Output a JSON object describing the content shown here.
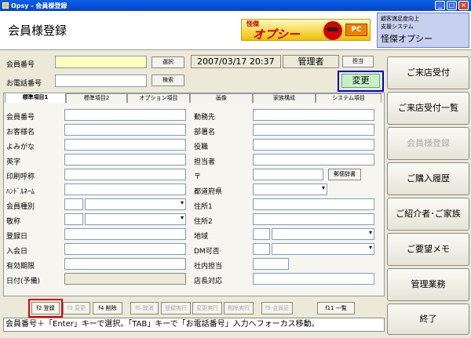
{
  "window": {
    "title": "Opsy - 会員様登録"
  },
  "header": {
    "page_title": "会員様登録",
    "logo_small": "怪傑",
    "logo_main": "オプシー",
    "logo_pc": "PC",
    "sys_line1": "顧客満足度向上",
    "sys_line2": "支援システム",
    "sys_line3": "怪傑オプシー"
  },
  "top": {
    "member_no_label": "会員番号",
    "phone_label": "お電話番号",
    "select_btn": "選択",
    "search_btn": "検索",
    "datetime": "2007/03/17 20:37",
    "staff": "管理者",
    "staff_btn": "担当",
    "change_btn": "変更"
  },
  "tabs": [
    "標準項目1",
    "標準項目2",
    "オプション項目",
    "画像",
    "家族構成",
    "システム項目"
  ],
  "form": {
    "left": [
      {
        "label": "会員番号"
      },
      {
        "label": "お客様名"
      },
      {
        "label": "よみがな"
      },
      {
        "label": "英字"
      },
      {
        "label": "印刷呼称"
      },
      {
        "label": "ﾊﾝﾄﾞﾙﾈｰﾑ"
      },
      {
        "label": "会員種別"
      },
      {
        "label": "敬称"
      },
      {
        "label": "登録日"
      },
      {
        "label": "入会日"
      },
      {
        "label": "有効期限"
      },
      {
        "label": "日付(予備)"
      }
    ],
    "right": [
      {
        "label": "勤務先"
      },
      {
        "label": "部署名"
      },
      {
        "label": "役職"
      },
      {
        "label": "担当者"
      },
      {
        "label": "〒"
      },
      {
        "label": "都道府県"
      },
      {
        "label": "住所1"
      },
      {
        "label": "住所2"
      },
      {
        "label": "地域"
      },
      {
        "label": "DM可否"
      },
      {
        "label": "社内担当"
      },
      {
        "label": "店長対応"
      }
    ],
    "zip_btn": "郵便辞書"
  },
  "right_menu": [
    "ご来店受付",
    "ご来店受付一覧",
    "会員様登録",
    "ご購入履歴",
    "ご紹介者･ご家族",
    "ご要望メモ",
    "管理業務",
    "終了"
  ],
  "fkeys": [
    "f2 登録",
    "f3 変更",
    "f4 削除",
    "f5 取消",
    "登録実行",
    "変更実行",
    "削除実行",
    "f9 会員証",
    "f11 一覧"
  ],
  "status": "会員番号＋「Enter」キーで選択。「TAB」キーで「お電話番号」入力へフォーカス移動。",
  "colors": {
    "highlight_red": "#e00000",
    "highlight_blue": "#0000cc",
    "change_btn_bg": "#c8f0c8"
  }
}
